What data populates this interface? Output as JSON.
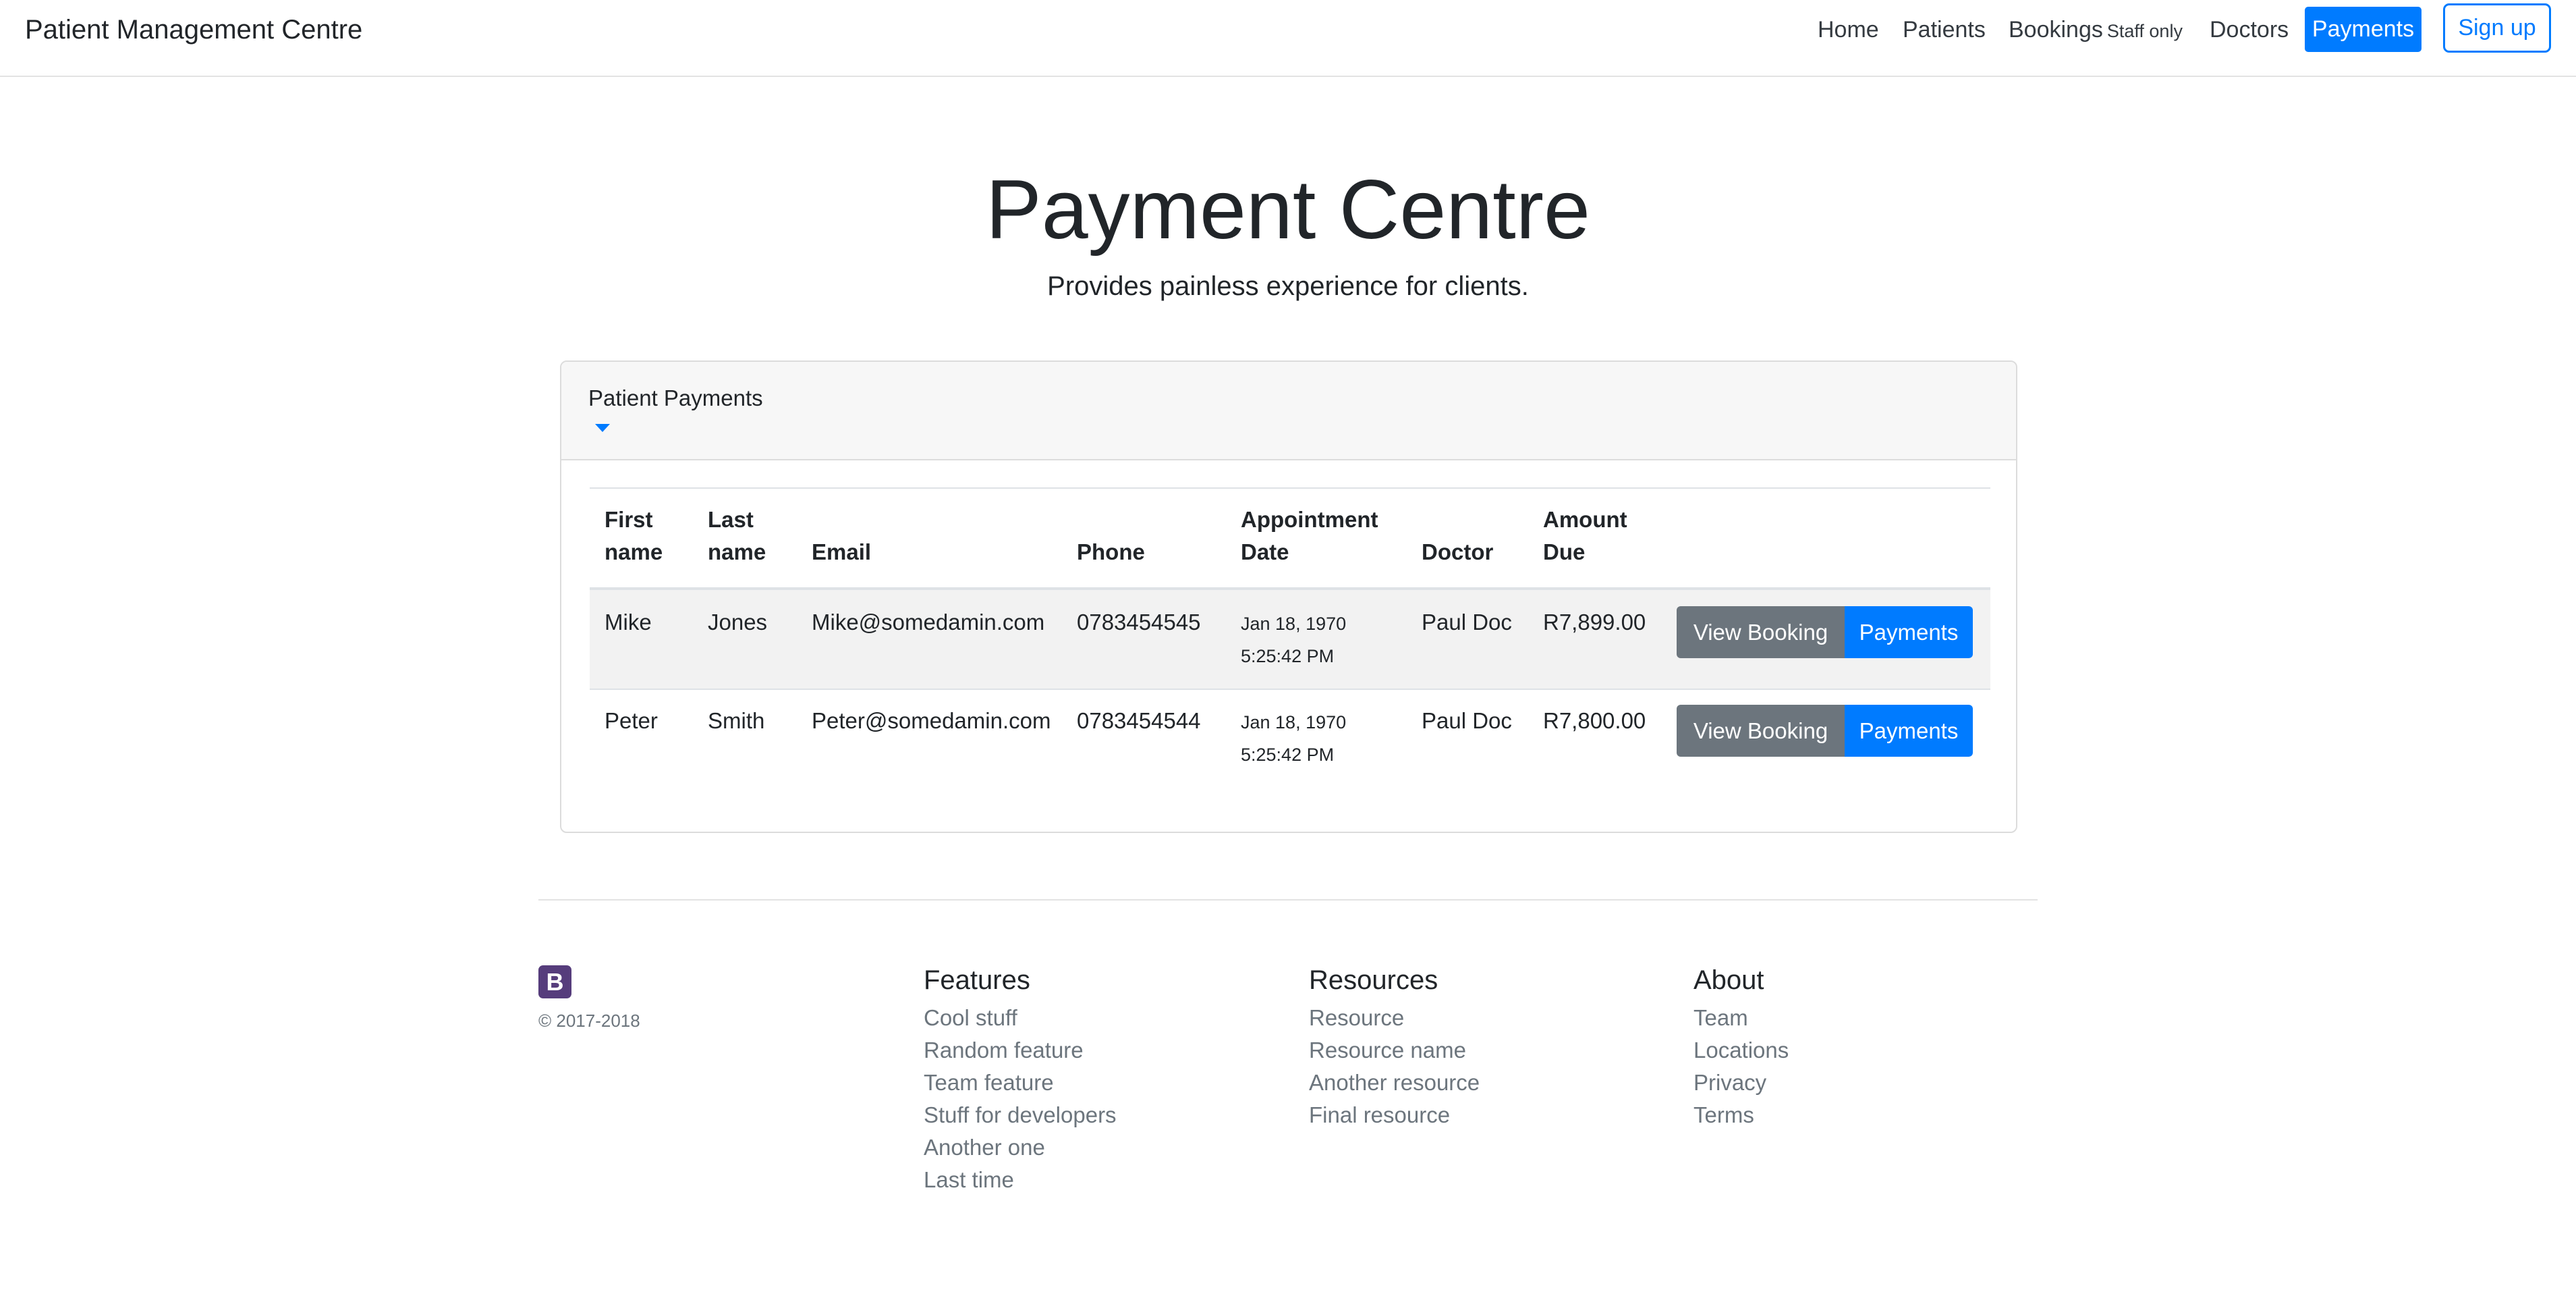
{
  "navbar": {
    "brand": "Patient Management Centre",
    "links": {
      "home": "Home",
      "patients": "Patients",
      "bookings": "Bookings",
      "bookings_badge": "Staff only",
      "doctors": "Doctors",
      "payments": "Payments"
    },
    "signup": "Sign up"
  },
  "hero": {
    "title": "Payment Centre",
    "subtitle": "Provides painless experience for clients."
  },
  "card": {
    "title": "Patient Payments"
  },
  "table": {
    "headers": {
      "first_name": [
        "First",
        "name"
      ],
      "last_name": [
        "Last",
        "name"
      ],
      "email": "Email",
      "phone": "Phone",
      "appointment_date": [
        "Appointment",
        "Date"
      ],
      "doctor": "Doctor",
      "amount_due": [
        "Amount",
        "Due"
      ]
    },
    "rows": [
      {
        "first_name": "Mike",
        "last_name": "Jones",
        "email": "Mike@somedamin.com",
        "phone": "0783454545",
        "date_line1": "Jan 18, 1970",
        "date_line2": "5:25:42 PM",
        "doctor": "Paul Doc",
        "amount_due": "R7,899.00",
        "view_booking": "View Booking",
        "payments": "Payments"
      },
      {
        "first_name": "Peter",
        "last_name": "Smith",
        "email": "Peter@somedamin.com",
        "phone": "0783454544",
        "date_line1": "Jan 18, 1970",
        "date_line2": "5:25:42 PM",
        "doctor": "Paul Doc",
        "amount_due": "R7,800.00",
        "view_booking": "View Booking",
        "payments": "Payments"
      }
    ]
  },
  "footer": {
    "logo_letter": "B",
    "copyright": "© 2017-2018",
    "columns": [
      {
        "title": "Features",
        "items": [
          "Cool stuff",
          "Random feature",
          "Team feature",
          "Stuff for developers",
          "Another one",
          "Last time"
        ]
      },
      {
        "title": "Resources",
        "items": [
          "Resource",
          "Resource name",
          "Another resource",
          "Final resource"
        ]
      },
      {
        "title": "About",
        "items": [
          "Team",
          "Locations",
          "Privacy",
          "Terms"
        ]
      }
    ]
  },
  "colors": {
    "primary": "#007bff",
    "secondary": "#6c757d",
    "logo": "#563d7c"
  }
}
